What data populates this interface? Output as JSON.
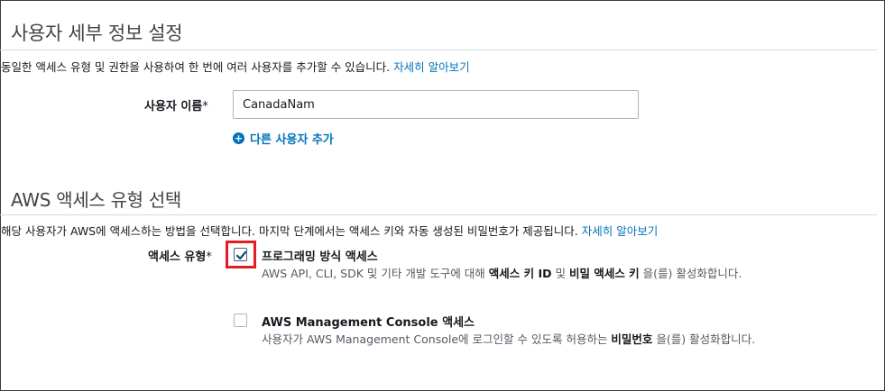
{
  "user_details": {
    "title": "사용자 세부 정보 설정",
    "description": "동일한 액세스 유형 및 권한을 사용하여 한 번에 여러 사용자를 추가할 수 있습니다.",
    "learn_more": "자세히 알아보기",
    "username_label": "사용자 이름",
    "required_mark": "*",
    "username_value": "CanadaNam",
    "add_user_label": "다른 사용자 추가"
  },
  "access_type": {
    "title": "AWS 액세스 유형 선택",
    "description": "해당 사용자가 AWS에 액세스하는 방법을 선택합니다. 마지막 단계에서는 액세스 키와 자동 생성된 비밀번호가 제공됩니다.",
    "learn_more": "자세히 알아보기",
    "label": "액세스 유형",
    "required_mark": "*",
    "options": [
      {
        "title": "프로그래밍 방식 액세스",
        "checked": true,
        "desc_prefix": "AWS API, CLI, SDK 및 기타 개발 도구에 대해 ",
        "bold1": "액세스 키 ID",
        "desc_mid": " 및 ",
        "bold2": "비밀 액세스 키",
        "desc_suffix": " 을(를) 활성화합니다."
      },
      {
        "title": "AWS Management Console 액세스",
        "checked": false,
        "desc_prefix": "사용자가 AWS Management Console에 로그인할 수 있도록 허용하는 ",
        "bold1": "비밀번호",
        "desc_suffix": " 을(를) 활성화합니다."
      }
    ]
  },
  "colors": {
    "link": "#0073bb",
    "highlight": "#e31b23",
    "check": "#0073bb"
  },
  "icons": {
    "add": "plus-circle-icon",
    "check": "checkmark-icon"
  }
}
